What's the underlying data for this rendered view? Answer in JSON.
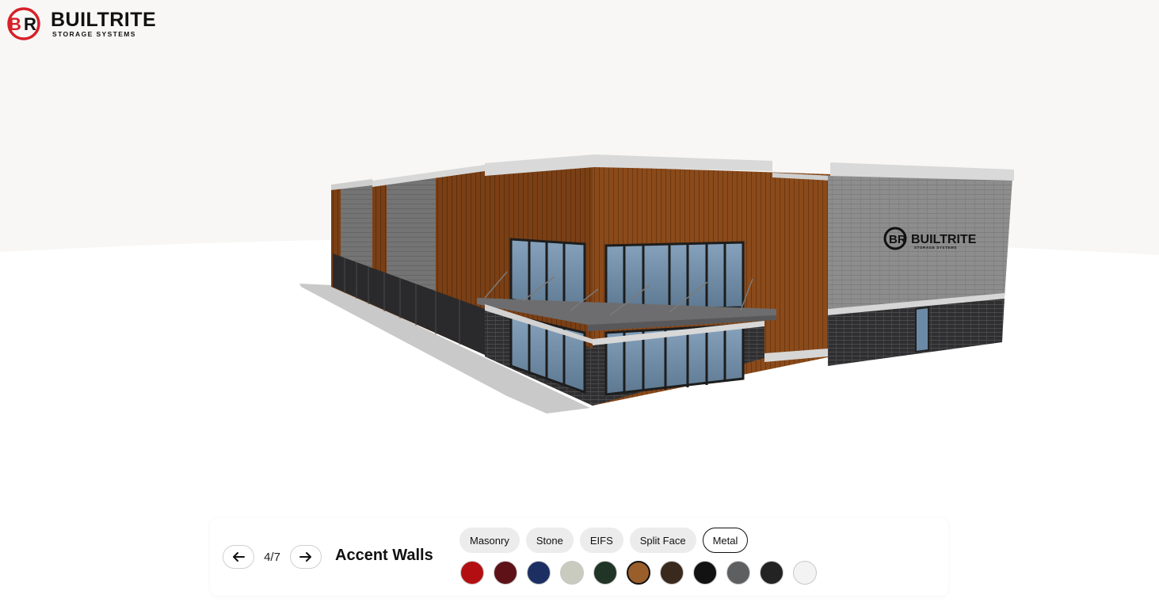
{
  "brand": {
    "name": "BUILTRITE",
    "tagline": "STORAGE SYSTEMS"
  },
  "colors": {
    "brand_red": "#d6212a",
    "ink": "#111111"
  },
  "viewer": {
    "icon": "building-3d-model",
    "sign_text": "BUILTRITE",
    "sign_subtext": "STORAGE SYSTEMS"
  },
  "config": {
    "step": "4/7",
    "section_title": "Accent Walls",
    "prev_icon": "arrow-left-icon",
    "next_icon": "arrow-right-icon",
    "tabs": [
      {
        "label": "Masonry",
        "active": false
      },
      {
        "label": "Stone",
        "active": false
      },
      {
        "label": "EIFS",
        "active": false
      },
      {
        "label": "Split Face",
        "active": false
      },
      {
        "label": "Metal",
        "active": true
      }
    ],
    "swatches": [
      {
        "color": "#b30f12",
        "selected": false
      },
      {
        "color": "#5e1218",
        "selected": false
      },
      {
        "color": "#1c2f63",
        "selected": false
      },
      {
        "color": "#c9cbbf",
        "selected": false
      },
      {
        "color": "#203525",
        "selected": false
      },
      {
        "color": "#9a5e2a",
        "selected": true
      },
      {
        "color": "#3a2a1e",
        "selected": false
      },
      {
        "color": "#121212",
        "selected": false
      },
      {
        "color": "#5e5f61",
        "selected": false
      },
      {
        "color": "#232323",
        "selected": false
      },
      {
        "color": "#f3f3f3",
        "selected": false
      }
    ]
  }
}
